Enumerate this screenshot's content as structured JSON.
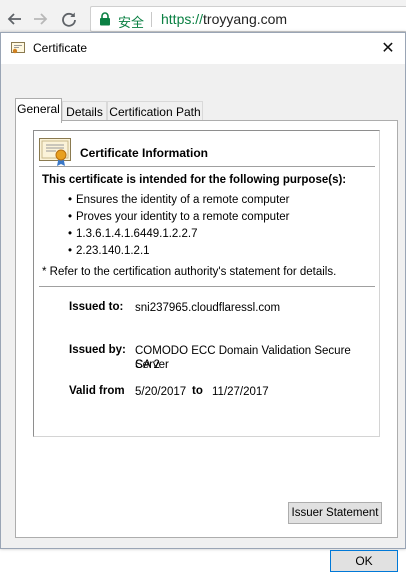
{
  "browser": {
    "secure_label": "安全",
    "url_scheme": "https://",
    "url_host": "troyyang.com"
  },
  "dialog": {
    "title": "Certificate",
    "close_glyph": "✕",
    "tabs": [
      {
        "label": "General",
        "active": true
      },
      {
        "label": "Details",
        "active": false
      },
      {
        "label": "Certification Path",
        "active": false
      }
    ],
    "info": {
      "heading": "Certificate Information",
      "purpose_title": "This certificate is intended for the following purpose(s):",
      "purposes": [
        "Ensures the identity of a remote computer",
        "Proves your identity to a remote computer",
        "1.3.6.1.4.1.6449.1.2.2.7",
        "2.23.140.1.2.1"
      ],
      "refer_note": "* Refer to the certification authority's statement for details.",
      "issued_to_label": "Issued to:",
      "issued_to_value": "sni237965.cloudflaressl.com",
      "issued_by_label": "Issued by:",
      "issued_by_value_line1": "COMODO ECC Domain Validation Secure Server",
      "issued_by_value_line2": "CA 2",
      "valid_from_label": "Valid from",
      "valid_from_value": "5/20/2017",
      "valid_to_label": "to",
      "valid_to_value": "11/27/2017"
    },
    "issuer_statement_label": "Issuer Statement",
    "ok_label": "OK"
  },
  "colors": {
    "secure_green": "#0b8043",
    "dialog_bg": "#f0f0f0",
    "button_face": "#e1e1e1",
    "focus_blue": "#0078d7"
  },
  "icons": [
    "back-arrow-icon",
    "forward-arrow-icon",
    "reload-icon",
    "lock-icon",
    "certificate-icon",
    "close-icon"
  ]
}
